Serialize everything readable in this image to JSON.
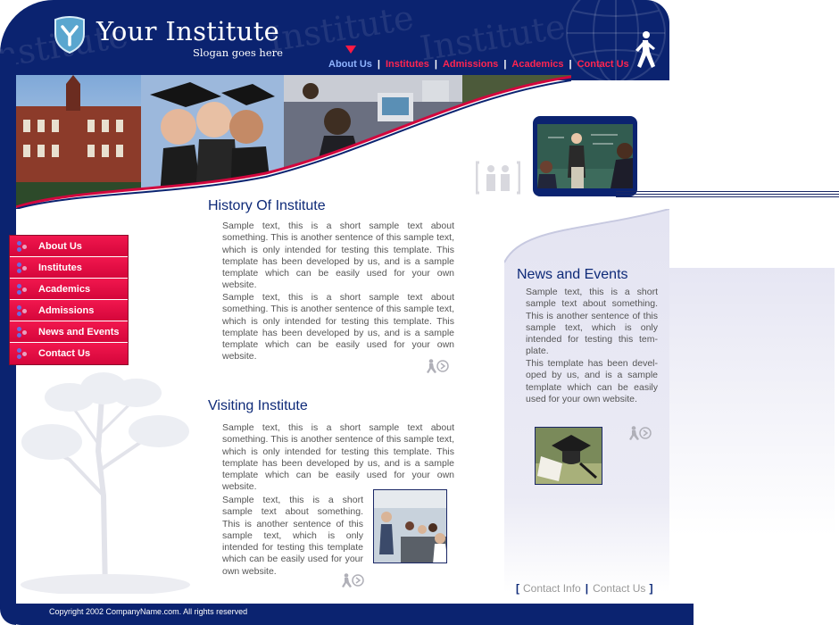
{
  "brand": {
    "title": "Your Institute",
    "slogan": "Slogan goes here",
    "watermark_word": "Institute"
  },
  "top_nav": [
    {
      "label": "About Us",
      "active": true
    },
    {
      "label": "Institutes",
      "active": false
    },
    {
      "label": "Admissions",
      "active": false
    },
    {
      "label": "Academics",
      "active": false
    },
    {
      "label": "Contact Us",
      "active": false
    }
  ],
  "side_menu": [
    {
      "label": "About Us"
    },
    {
      "label": "Institutes"
    },
    {
      "label": "Academics"
    },
    {
      "label": "Admissions"
    },
    {
      "label": "News and Events"
    },
    {
      "label": "Contact Us"
    }
  ],
  "history": {
    "title": "History Of Institute",
    "text": "Sample text, this is a short sample text about something. This is another sentence of this sample text, which is only intended for testing this template. This template has been developed by us, and is a sample template which can be easily used for your own website.",
    "text2": "Sample text, this is a short sample text about something. This is another sentence of this sample text, which is only intended for testing this template. This template has been developed by us, and is a sample template which can be easily used for your own website."
  },
  "visiting": {
    "title": "Visiting Institute",
    "text": "Sample text, this is a short sample text about something. This is another sentence of this sample text, which is only intended for testing this template. This template has been developed by us, and is a sample template which can be easily used for your own website.",
    "text2": "Sample text, this is a short sample text about something. This is another sentence of this sample text, which is only intended for testing this template which can be easily used for your own website."
  },
  "news": {
    "title": "News and Events",
    "text": "Sample text, this is a short sample text about something. This is another sentence of this sample text, which is only intended for testing this tem-plate.",
    "text2": "This template has been devel-oped by us, and is a sample template which can be easily used for your own website."
  },
  "footer": {
    "links": [
      {
        "label": "Contact Info"
      },
      {
        "label": "Contact Us"
      }
    ],
    "copyright": "Copyright 2002 CompanyName.com. All rights reserved"
  },
  "colors": {
    "navy": "#0b2370",
    "menu_red": "#e10840",
    "nav_link_red": "#ff2450",
    "nav_active": "#8fb4ff",
    "heading_blue": "#0e2a78"
  }
}
